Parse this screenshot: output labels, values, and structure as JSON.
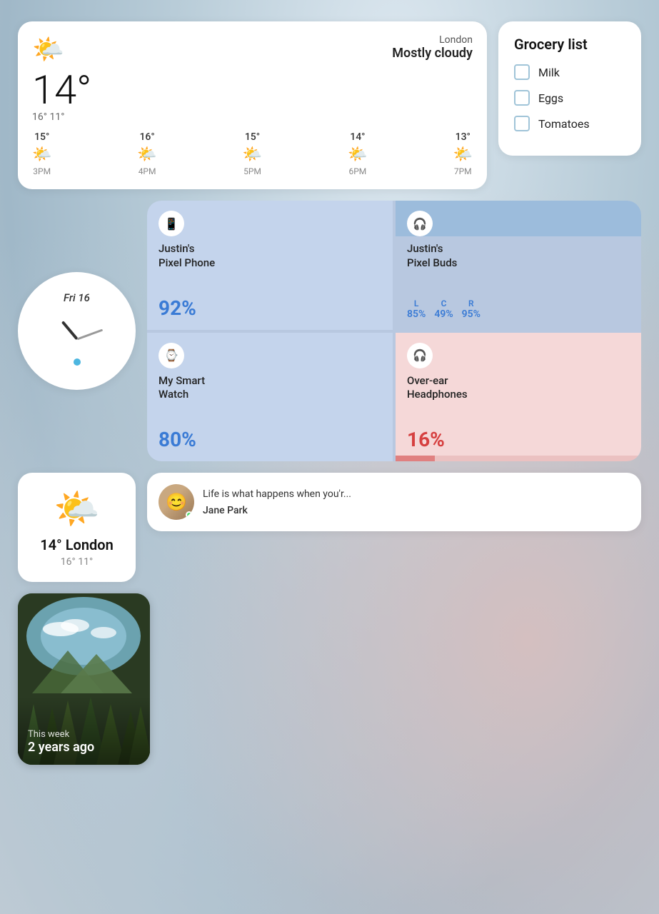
{
  "weather": {
    "location": "London",
    "condition": "Mostly cloudy",
    "temp_current": "14°",
    "hi": "16°",
    "lo": "11°",
    "icon": "🌤️",
    "forecast": [
      {
        "time": "3PM",
        "temp": "15°",
        "icon": "🌤️"
      },
      {
        "time": "4PM",
        "temp": "16°",
        "icon": "🌤️"
      },
      {
        "time": "5PM",
        "temp": "15°",
        "icon": "🌤️"
      },
      {
        "time": "6PM",
        "temp": "14°",
        "icon": "🌤️"
      },
      {
        "time": "7PM",
        "temp": "13°",
        "icon": "🌤️"
      }
    ]
  },
  "grocery": {
    "title": "Grocery list",
    "items": [
      "Milk",
      "Eggs",
      "Tomatoes"
    ]
  },
  "clock": {
    "day": "Fri",
    "date": "16"
  },
  "devices": [
    {
      "id": "pixel-phone",
      "name": "Justin's Pixel Phone",
      "battery": "92%",
      "icon": "📱",
      "low": false
    },
    {
      "id": "pixel-buds",
      "name": "Justin's Pixel Buds",
      "icon": "🎧",
      "low": false,
      "buds": [
        {
          "label": "L",
          "value": "85%"
        },
        {
          "label": "C",
          "value": "49%"
        },
        {
          "label": "R",
          "value": "95%"
        }
      ]
    },
    {
      "id": "smartwatch",
      "name": "My Smart Watch",
      "battery": "80%",
      "icon": "⌚",
      "low": false
    },
    {
      "id": "headphones",
      "name": "Over-ear Headphones",
      "battery": "16%",
      "icon": "🎧",
      "low": true,
      "bar_width": "16"
    }
  ],
  "weather_small": {
    "icon": "🌤️",
    "temp": "14° London",
    "hilo": "16° 11°"
  },
  "message": {
    "text": "Life is what happens when you'r...",
    "sender": "Jane Park"
  },
  "memory": {
    "sub": "This week",
    "main": "2 years ago"
  }
}
